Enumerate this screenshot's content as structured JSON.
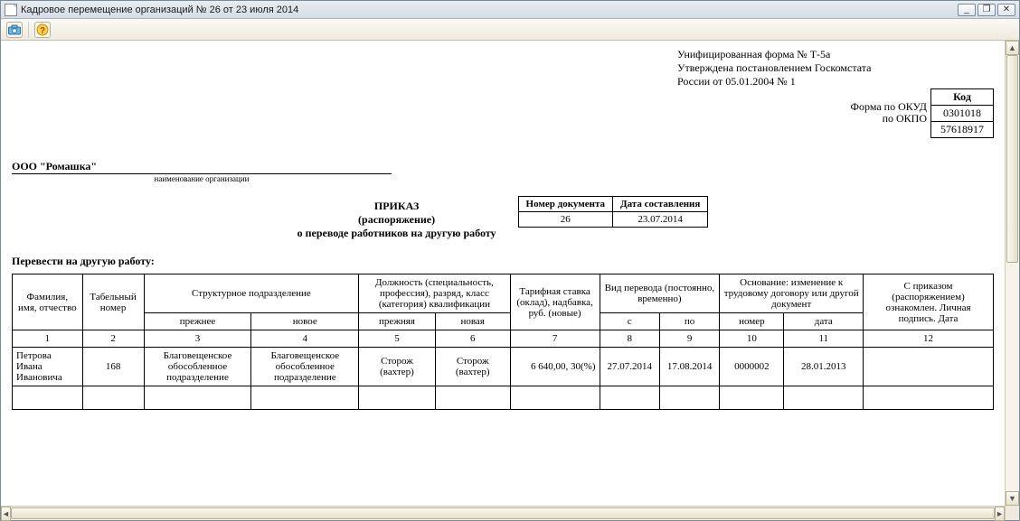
{
  "window": {
    "title": "Кадровое перемещение организаций № 26 от 23 июля 2014"
  },
  "form_meta": {
    "line1": "Унифицированная форма № Т-5а",
    "line2": "Утверждена постановлением Госкомстата",
    "line3": "России от 05.01.2004 № 1"
  },
  "codes": {
    "kod_label": "Код",
    "okud_label": "Форма по ОКУД",
    "okud_value": "0301018",
    "okpo_label": "по ОКПО",
    "okpo_value": "57618917"
  },
  "org": {
    "name": "ООО \"Ромашка\"",
    "caption": "наименование организации"
  },
  "docnum": {
    "h_num": "Номер документа",
    "h_date": "Дата составления",
    "num": "26",
    "date": "23.07.2014"
  },
  "titles": {
    "prikaz": "ПРИКАЗ",
    "rasp": "(распоряжение)",
    "about": "о переводе работников на другую работу"
  },
  "transfer_line": "Перевести на другую работу:",
  "headers": {
    "fio": "Фамилия, имя, отчество",
    "tab": "Табельный номер",
    "struct": "Структурное подразделение",
    "position": "Должность (специальность, профессия), разряд, класс (категория) квалификации",
    "tariff": "Тарифная ставка (оклад), надбавка, руб. (новые)",
    "transfer_type": "Вид перевода (постоянно, временно)",
    "basis": "Основание: изменение к трудовому договору или другой документ",
    "ack": "С приказом (распоряжением) ознакомлен. Личная подпись. Дата",
    "prev": "прежнее",
    "new": "новое",
    "prev2": "прежняя",
    "new2": "новая",
    "from": "с",
    "to": "по",
    "bnum": "номер",
    "bdate": "дата"
  },
  "cols": [
    "1",
    "2",
    "3",
    "4",
    "5",
    "6",
    "7",
    "8",
    "9",
    "10",
    "11",
    "12"
  ],
  "row": {
    "fio": "Петрова Ивана Ивановича",
    "tab": "168",
    "struct_prev": "Благовещенское обособленное подразделение",
    "struct_new": "Благовещенское обособленное подразделение",
    "pos_prev": "Сторож (вахтер)",
    "pos_new": "Сторож (вахтер)",
    "tariff": "6 640,00, 30(%)",
    "from": "27.07.2014",
    "to": "17.08.2014",
    "bnum": "0000002",
    "bdate": "28.01.2013",
    "ack": ""
  }
}
